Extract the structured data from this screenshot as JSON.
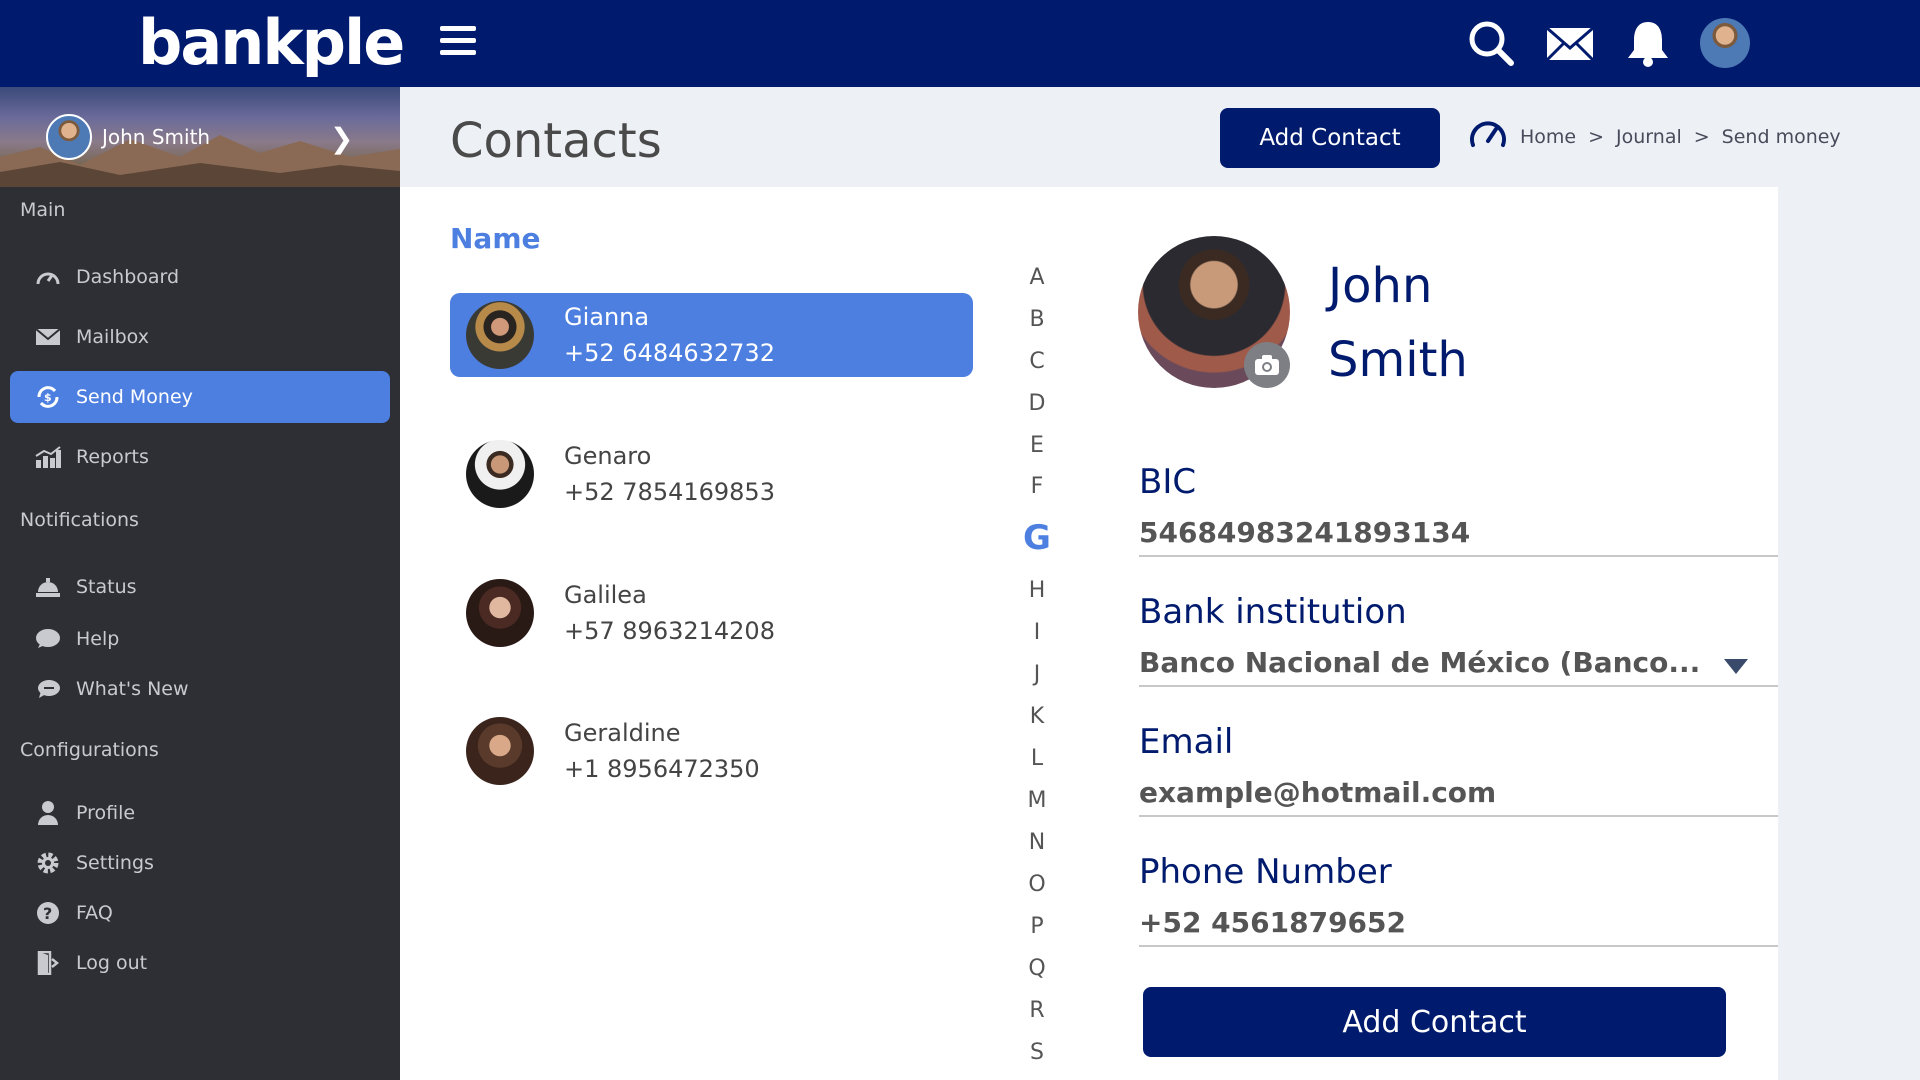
{
  "brand": {
    "name": "bankple"
  },
  "user": {
    "name": "John Smith"
  },
  "sidebar": {
    "sections": [
      {
        "title": "Main"
      },
      {
        "title": "Notifications"
      },
      {
        "title": "Configurations"
      }
    ],
    "items": [
      {
        "label": "Dashboard",
        "icon": "gauge-icon"
      },
      {
        "label": "Mailbox",
        "icon": "envelope-icon"
      },
      {
        "label": "Send Money",
        "icon": "money-transfer-icon",
        "active": true
      },
      {
        "label": "Reports",
        "icon": "bar-chart-icon"
      },
      {
        "label": "Status",
        "icon": "service-bell-icon"
      },
      {
        "label": "Help",
        "icon": "chat-bubble-icon"
      },
      {
        "label": "What's New",
        "icon": "megaphone-icon"
      },
      {
        "label": "Profile",
        "icon": "person-icon"
      },
      {
        "label": "Settings",
        "icon": "gear-icon"
      },
      {
        "label": "FAQ",
        "icon": "question-circle-icon"
      },
      {
        "label": "Log out",
        "icon": "exit-door-icon"
      }
    ]
  },
  "header": {
    "title": "Contacts",
    "add_button": "Add Contact",
    "breadcrumb": [
      "Home",
      "Journal",
      "Send money"
    ],
    "breadcrumb_sep": ">"
  },
  "contacts": {
    "header": "Name",
    "list": [
      {
        "name": "Gianna",
        "phone": "+52 6484632732",
        "selected": true
      },
      {
        "name": "Genaro",
        "phone": "+52 7854169853"
      },
      {
        "name": "Galilea",
        "phone": "+57 8963214208"
      },
      {
        "name": "Geraldine",
        "phone": "+1 8956472350"
      }
    ]
  },
  "alphabet": {
    "letters": [
      "A",
      "B",
      "C",
      "D",
      "E",
      "F",
      "G",
      "H",
      "I",
      "J",
      "K",
      "L",
      "M",
      "N",
      "O",
      "P",
      "Q",
      "R",
      "S"
    ],
    "active": "G"
  },
  "detail": {
    "first_name": "John",
    "last_name": "Smith",
    "bic_label": "BIC",
    "bic_value": "54684983241893134",
    "bank_label": "Bank institution",
    "bank_value": "Banco Nacional de México (Banco...",
    "email_label": "Email",
    "email_value": "example@hotmail.com",
    "phone_label": "Phone Number",
    "phone_value": "+52 4561879652",
    "submit": "Add Contact"
  },
  "colors": {
    "navy": "#001a6e",
    "accent": "#4d7fe0",
    "sidebar": "#2d2f35"
  }
}
